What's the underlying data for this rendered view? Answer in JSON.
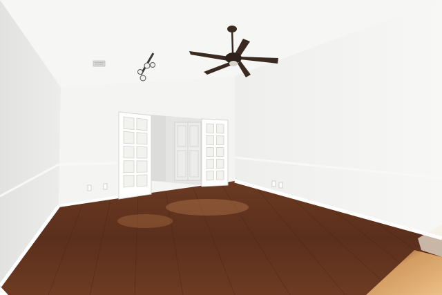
{
  "scene": {
    "kind": "empty-room-interior",
    "colors": {
      "wall_left": "#e9e9e7",
      "wall_back": "#f4f4f2",
      "wall_right": "#f1f1ef",
      "ceiling": "#f6f6f4",
      "floor": "#5a2f1c",
      "floor_light": "#9a5a34",
      "trim": "#ffffff",
      "door_glass": "#f2f2ef",
      "fan": "#3a2a22"
    },
    "fixtures": {
      "ceiling_fan_blades": 5,
      "french_doors": 2,
      "french_door_panes_per_door": 10,
      "closet_doors": 2
    },
    "icons": [
      "ceiling-fan-icon",
      "track-light-icon",
      "air-vent-icon"
    ]
  }
}
